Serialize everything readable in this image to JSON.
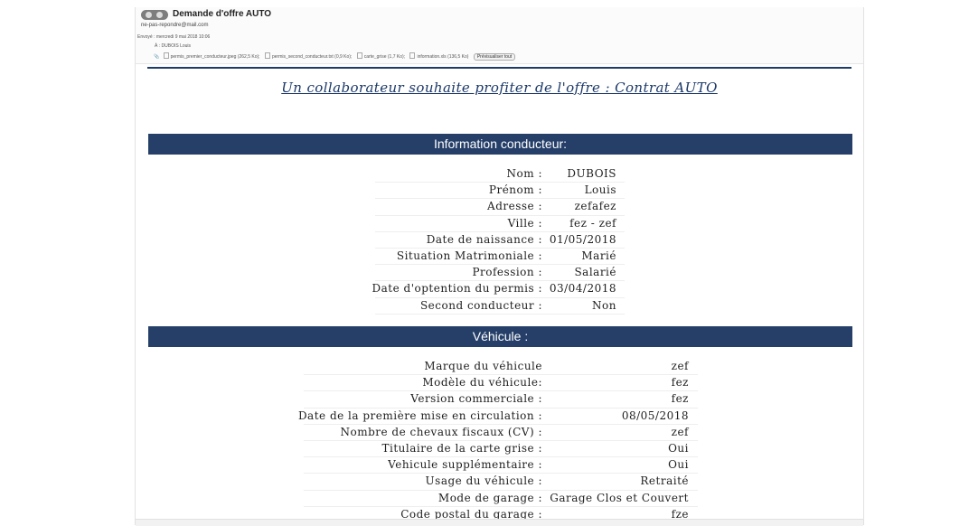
{
  "email": {
    "subject": "Demande d'offre AUTO",
    "sender": "ne-pas-repondre@mail.com",
    "sent_label": "Envoyé :",
    "sent_value": "mercredi 9 mai 2018 10:06",
    "to_label": "À :",
    "to_value": "DUBOIS Louis",
    "attachments": [
      "permis_premier_conducteur.jpeg (262,5 Ko);",
      "permis_second_conducteur.txt (0,9 Ko);",
      "carte_grise (1,7 Ko);",
      "information.xls (136,5 Ko)"
    ],
    "preview_all": "Prévisualiser tout",
    "icons": {
      "nav": "navigation-arrows-icon",
      "attachment": "paperclip-icon",
      "file": "document-icon"
    }
  },
  "body": {
    "headline": "Un collaborateur souhaite profiter de l'offre : Contrat AUTO",
    "driver_section": {
      "title": "Information conducteur:",
      "rows": [
        {
          "label": "Nom :",
          "value": "DUBOIS"
        },
        {
          "label": "Prénom :",
          "value": "Louis"
        },
        {
          "label": "Adresse :",
          "value": "zefafez"
        },
        {
          "label": "Ville :",
          "value": "fez - zef"
        },
        {
          "label": "Date de naissance :",
          "value": "01/05/2018"
        },
        {
          "label": "Situation Matrimoniale :",
          "value": "Marié"
        },
        {
          "label": "Profession :",
          "value": "Salarié"
        },
        {
          "label": "Date d'optention du permis :",
          "value": "03/04/2018"
        },
        {
          "label": "Second conducteur :",
          "value": "Non"
        }
      ]
    },
    "vehicle_section": {
      "title": "Véhicule :",
      "rows": [
        {
          "label": "Marque du véhicule",
          "value": "zef"
        },
        {
          "label": "Modèle du véhicule:",
          "value": "fez"
        },
        {
          "label": "Version commerciale :",
          "value": "fez"
        },
        {
          "label": "Date de la première mise en circulation :",
          "value": "08/05/2018"
        },
        {
          "label": "Nombre de chevaux fiscaux (CV) :",
          "value": "zef"
        },
        {
          "label": "Titulaire de la carte grise :",
          "value": "Oui"
        },
        {
          "label": "Vehicule supplémentaire :",
          "value": "Oui"
        },
        {
          "label": "Usage du véhicule :",
          "value": "Retraité"
        },
        {
          "label": "Mode de garage :",
          "value": "Garage Clos et Couvert"
        },
        {
          "label": "Code postal du garage :",
          "value": "fze"
        }
      ]
    }
  },
  "colors": {
    "band": "#253f69",
    "headline": "#1b3868",
    "divider": "#1e3b66"
  }
}
